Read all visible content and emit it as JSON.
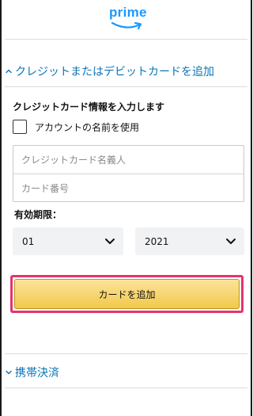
{
  "header": {
    "logo_text": "prime"
  },
  "card_section": {
    "toggle_label": "クレジットまたはデビットカードを追加",
    "form_title": "クレジットカード情報を入力します",
    "use_account_name_label": "アカウントの名前を使用",
    "use_account_name_checked": false,
    "cardholder_placeholder": "クレジットカード名義人",
    "card_number_placeholder": "カード番号",
    "expiry_label": "有効期限：",
    "expiry_month": "01",
    "expiry_year": "2021",
    "add_card_label": "カードを追加"
  },
  "mobile_section": {
    "toggle_label": "携帯決済"
  },
  "colors": {
    "prime_blue": "#1a98ff",
    "link_blue": "#0a74b5",
    "button_yellow": "#f2c94c",
    "highlight_pink": "#e8336e"
  },
  "icons": {
    "expanded_caret": "chevron-up-icon",
    "collapsed_caret": "chevron-down-icon",
    "select_arrow": "chevron-down-icon"
  }
}
